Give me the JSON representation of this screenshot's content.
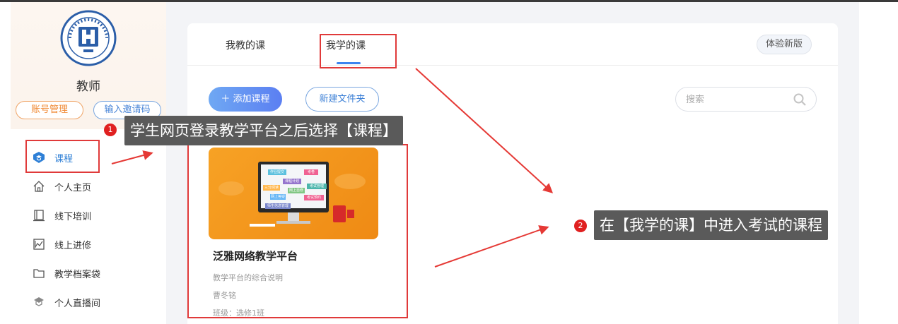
{
  "sidebar": {
    "logo_icon": "university-seal-icon",
    "role": "教师",
    "account_btn": "账号管理",
    "invite_btn": "输入邀请码",
    "items": [
      {
        "label": "课程",
        "icon": "graduation-cap-icon",
        "active": true
      },
      {
        "label": "个人主页",
        "icon": "home-icon"
      },
      {
        "label": "线下培训",
        "icon": "book-icon"
      },
      {
        "label": "线上进修",
        "icon": "chart-book-icon"
      },
      {
        "label": "教学档案袋",
        "icon": "folder-icon"
      },
      {
        "label": "个人直播间",
        "icon": "live-icon"
      }
    ]
  },
  "tabs": [
    {
      "label": "我教的课",
      "active": false
    },
    {
      "label": "我学的课",
      "active": true
    }
  ],
  "new_version_btn": "体验新版",
  "toolbar": {
    "add_course": "＋ 添加课程",
    "new_folder": "新建文件夹",
    "search_placeholder": "搜索"
  },
  "course": {
    "title": "泛雅网络教学平台",
    "description": "教学平台的综合说明",
    "teacher": "曹冬铭",
    "class": "班级：选修1班",
    "thumb_labels": [
      "作业提交",
      "考卷",
      "课程计划",
      "三分阅读",
      "考试管理",
      "网上自修",
      "网上答疑",
      "考试预约",
      "师生信息管理"
    ]
  },
  "annotations": {
    "step1_number": "1",
    "step1_text": "学生网页登录教学平台之后选择【课程】",
    "step2_number": "2",
    "step2_text": "在【我学的课】中进入考试的课程"
  },
  "colors": {
    "accent": "#3b84f0",
    "orange": "#f08a35",
    "annotation_red": "#e03a3a"
  }
}
